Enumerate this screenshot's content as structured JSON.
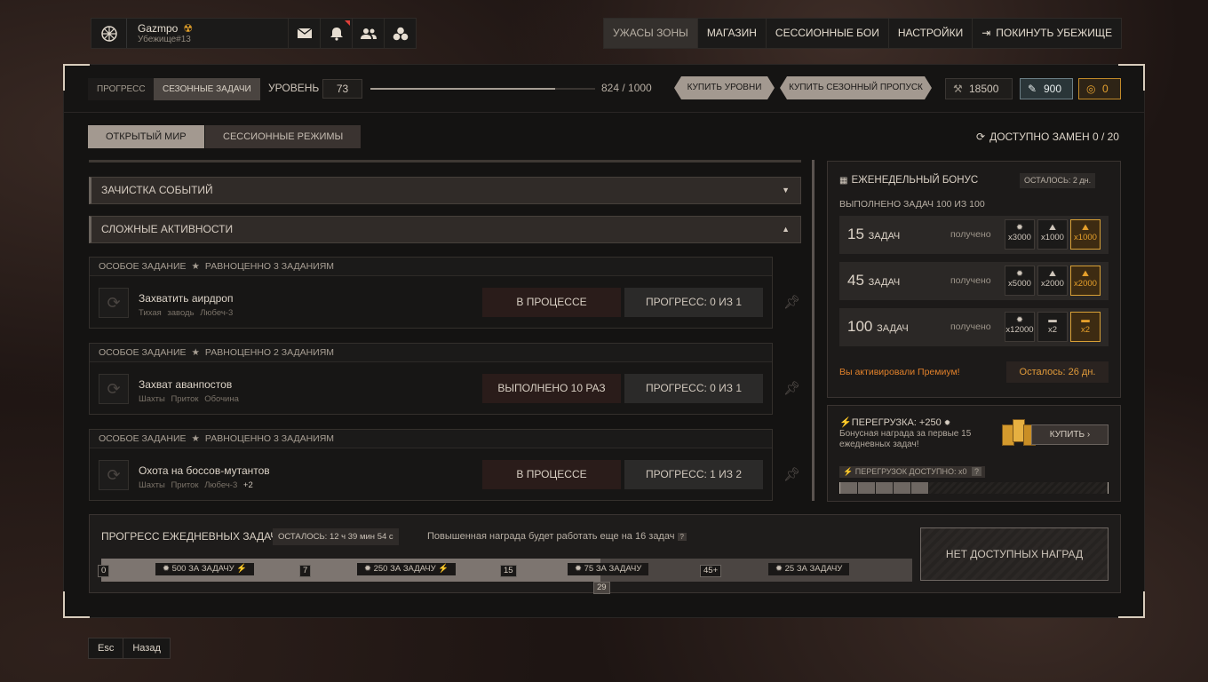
{
  "user": {
    "name": "Gazmpo",
    "tag": "Убежище#13"
  },
  "nav": [
    "УЖАСЫ ЗОНЫ",
    "МАГАЗИН",
    "СЕССИОННЫЕ БОИ",
    "НАСТРОЙКИ",
    "ПОКИНУТЬ УБЕЖИЩЕ"
  ],
  "header": {
    "tab_progress": "ПРОГРЕСС",
    "tab_seasonal": "СЕЗОННЫЕ ЗАДАЧИ",
    "level_label": "УРОВЕНЬ",
    "level_value": "73",
    "xp_text": "824 / 1000",
    "xp_fraction": 0.824,
    "buy_levels": "КУПИТЬ УРОВНИ",
    "buy_pass": "КУПИТЬ СЕЗОННЫЙ ПРОПУСК",
    "currency1": "18500",
    "currency2": "900",
    "currency3": "0"
  },
  "sections": {
    "open_world": "ОТКРЫТЫЙ МИР",
    "session_modes": "СЕССИОННЫЕ РЕЖИМЫ"
  },
  "swaps": "ДОСТУПНО ЗАМЕН 0 / 20",
  "accordions": [
    "ЗАЧИСТКА СОБЫТИЙ",
    "СЛОЖНЫЕ АКТИВНОСТИ"
  ],
  "tasks": [
    {
      "header": "ОСОБОЕ ЗАДАНИЕ",
      "equiv": "РАВНОЦЕННО 3 ЗАДАНИЯМ",
      "name": "Захватить аирдроп",
      "locations": "Тихая заводь  Любеч-3",
      "status": "В ПРОЦЕССЕ",
      "progress": "ПРОГРЕСС: 0 ИЗ 1"
    },
    {
      "header": "ОСОБОЕ ЗАДАНИЕ",
      "equiv": "РАВНОЦЕННО 2 ЗАДАНИЯМ",
      "name": "Захват аванпостов",
      "locations": "Шахты  Приток  Обочина",
      "status": "ВЫПОЛНЕНО 10 РАЗ",
      "progress": "ПРОГРЕСС: 0 ИЗ 1"
    },
    {
      "header": "ОСОБОЕ ЗАДАНИЕ",
      "equiv": "РАВНОЦЕННО 3 ЗАДАНИЯМ",
      "name": "Охота на боссов-мутантов",
      "locations": "Шахты  Приток  Любеч-3",
      "extra": "+2",
      "status": "В ПРОЦЕССЕ",
      "progress": "ПРОГРЕСС: 1 ИЗ 2"
    }
  ],
  "weekly": {
    "title": "ЕЖЕНЕДЕЛЬНЫЙ БОНУС",
    "remaining": "ОСТАЛОСЬ: 2 дн.",
    "completed": "ВЫПОЛНЕНО ЗАДАЧ 100 ИЗ 100",
    "task_word": "ЗАДАЧ",
    "received": "получено",
    "rows": [
      {
        "count": "15",
        "rewards": [
          "x3000",
          "x1000",
          "x1000"
        ]
      },
      {
        "count": "45",
        "rewards": [
          "x5000",
          "x2000",
          "x2000"
        ]
      },
      {
        "count": "100",
        "rewards": [
          "x12000",
          "x2",
          "x2"
        ]
      }
    ],
    "premium": "Вы активировали Премиум!",
    "premium_left": "Осталось: 26 дн."
  },
  "overload": {
    "title": "ПЕРЕГРУЗКА: +250",
    "desc": "Бонусная награда за первые 15 ежедневных задач!",
    "buy": "КУПИТЬ",
    "available": "ПЕРЕГРУЗОК ДОСТУПНО: x0",
    "filled_segments": 5,
    "total_segments": 15
  },
  "daily": {
    "title": "ПРОГРЕСС ЕЖЕДНЕВНЫХ ЗАДАЧ",
    "left": "ОСТАЛОСЬ: 12 ч 39 мин 54 с",
    "boost": "Повышенная награда будет работать еще на 16 задач",
    "no_rewards": "НЕТ ДОСТУПНЫХ НАГРАД",
    "marks": [
      "0",
      "7",
      "15",
      "45+"
    ],
    "current": "29",
    "segments": [
      "500 ЗА ЗАДАЧУ",
      "250 ЗА ЗАДАЧУ",
      "75 ЗА ЗАДАЧУ",
      "25 ЗА ЗАДАЧУ"
    ]
  },
  "footer": {
    "esc": "Esc",
    "back": "Назад"
  }
}
